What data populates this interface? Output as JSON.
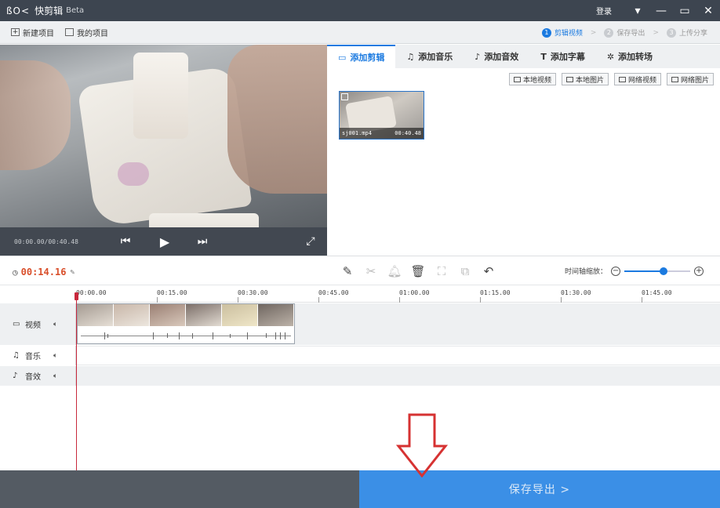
{
  "window": {
    "logo": "ßO<",
    "title": "快剪辑",
    "beta": "Beta",
    "login": "登录"
  },
  "toolbar": {
    "new_project": "新建项目",
    "my_projects": "我的项目"
  },
  "steps": [
    {
      "num": "1",
      "label": "剪辑视频",
      "active": true
    },
    {
      "num": "2",
      "label": "保存导出",
      "active": false
    },
    {
      "num": "3",
      "label": "上传分享",
      "active": false
    }
  ],
  "preview": {
    "time": "00:00.00/00:40.48"
  },
  "media_tabs": [
    {
      "label": "添加剪辑",
      "icon": "video-icon",
      "active": true
    },
    {
      "label": "添加音乐",
      "icon": "music-icon",
      "active": false
    },
    {
      "label": "添加音效",
      "icon": "sound-effect-icon",
      "active": false
    },
    {
      "label": "添加字幕",
      "icon": "text-icon",
      "active": false
    },
    {
      "label": "添加转场",
      "icon": "transition-icon",
      "active": false
    }
  ],
  "source_buttons": [
    "本地视频",
    "本地图片",
    "网络视频",
    "网络图片"
  ],
  "media_clip": {
    "name": "sj001.mp4",
    "duration": "00:40.48"
  },
  "timeline": {
    "current_time": "00:14.16",
    "zoom_label": "时间轴缩放：",
    "zoom_level": 0.6,
    "ruler": [
      "00:00.00",
      "00:15.00",
      "00:30.00",
      "00:45.00",
      "01:00.00",
      "01:15.00",
      "01:30.00",
      "01:45.00"
    ],
    "tracks": [
      {
        "label": "视频",
        "icon": "video-track-icon"
      },
      {
        "label": "音乐",
        "icon": "music-track-icon"
      },
      {
        "label": "音效",
        "icon": "sound-effect-track-icon"
      }
    ]
  },
  "bottom": {
    "save_export": "保存导出 >"
  },
  "colors": {
    "accent": "#1b7ae0",
    "save_button": "#3b8fe6",
    "current_time": "#d94f2b",
    "playhead": "#c8283c",
    "arrow": "#d63232"
  }
}
